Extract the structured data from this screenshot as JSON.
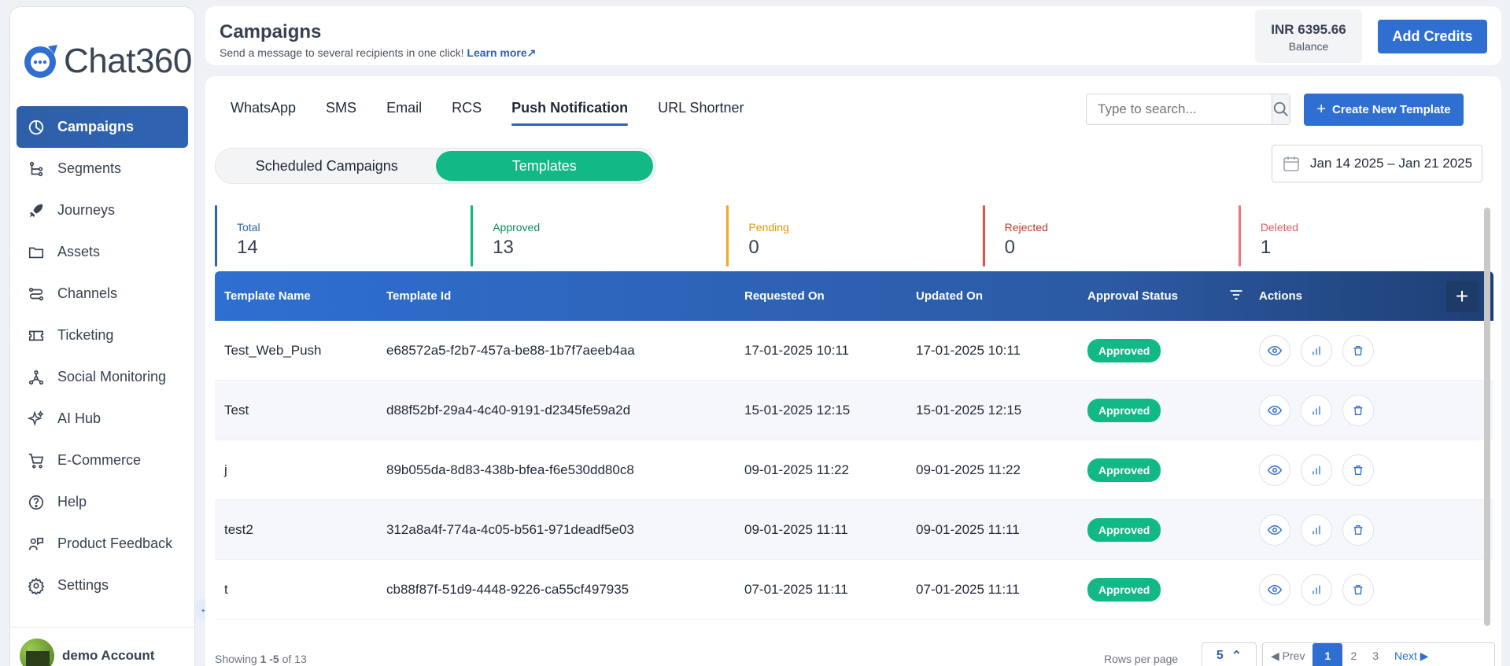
{
  "brand": {
    "name": "Chat360"
  },
  "sidebar": {
    "items": [
      {
        "label": "Campaigns",
        "icon": "pie-chart-icon",
        "active": true
      },
      {
        "label": "Segments",
        "icon": "segments-icon"
      },
      {
        "label": "Journeys",
        "icon": "rocket-icon"
      },
      {
        "label": "Assets",
        "icon": "folder-icon"
      },
      {
        "label": "Channels",
        "icon": "channels-icon"
      },
      {
        "label": "Ticketing",
        "icon": "ticket-icon"
      },
      {
        "label": "Social Monitoring",
        "icon": "network-icon"
      },
      {
        "label": "AI Hub",
        "icon": "sparkle-icon"
      },
      {
        "label": "E-Commerce",
        "icon": "cart-icon"
      },
      {
        "label": "Help",
        "icon": "help-icon"
      },
      {
        "label": "Product Feedback",
        "icon": "feedback-icon"
      },
      {
        "label": "Settings",
        "icon": "gear-icon"
      }
    ],
    "account_name": "demo Account"
  },
  "header": {
    "title": "Campaigns",
    "subtitle": "Send a message to several recipients in one click!",
    "learn_more": "Learn more",
    "balance_amount": "INR 6395.66",
    "balance_label": "Balance",
    "add_credits": "Add Credits"
  },
  "tabs": [
    "WhatsApp",
    "SMS",
    "Email",
    "RCS",
    "Push Notification",
    "URL Shortner"
  ],
  "active_tab": "Push Notification",
  "search": {
    "placeholder": "Type to search..."
  },
  "create_button": "Create New Template",
  "toggle": {
    "options": [
      "Scheduled Campaigns",
      "Templates"
    ],
    "active": "Templates"
  },
  "date_range": "Jan 14 2025 – Jan 21 2025",
  "stats": [
    {
      "label": "Total",
      "value": "14",
      "key": "total"
    },
    {
      "label": "Approved",
      "value": "13",
      "key": "approved"
    },
    {
      "label": "Pending",
      "value": "0",
      "key": "pending"
    },
    {
      "label": "Rejected",
      "value": "0",
      "key": "rejected"
    },
    {
      "label": "Deleted",
      "value": "1",
      "key": "deleted"
    }
  ],
  "table": {
    "headers": [
      "Template Name",
      "Template Id",
      "Requested On",
      "Updated On",
      "Approval Status",
      "Actions"
    ],
    "rows": [
      {
        "name": "Test_Web_Push",
        "id": "e68572a5-f2b7-457a-be88-1b7f7aeeb4aa",
        "requested": "17-01-2025 10:11",
        "updated": "17-01-2025 10:11",
        "status": "Approved"
      },
      {
        "name": "Test",
        "id": "d88f52bf-29a4-4c40-9191-d2345fe59a2d",
        "requested": "15-01-2025 12:15",
        "updated": "15-01-2025 12:15",
        "status": "Approved"
      },
      {
        "name": "j",
        "id": "89b055da-8d83-438b-bfea-f6e530dd80c8",
        "requested": "09-01-2025 11:22",
        "updated": "09-01-2025 11:22",
        "status": "Approved"
      },
      {
        "name": "test2",
        "id": "312a8a4f-774a-4c05-b561-971deadf5e03",
        "requested": "09-01-2025 11:11",
        "updated": "09-01-2025 11:11",
        "status": "Approved"
      },
      {
        "name": "t",
        "id": "cb88f87f-51d9-4448-9226-ca55cf497935",
        "requested": "07-01-2025 11:11",
        "updated": "07-01-2025 11:11",
        "status": "Approved"
      }
    ]
  },
  "footer": {
    "showing_prefix": "Showing ",
    "showing_range": "1 -5",
    "showing_suffix": " of 13",
    "rows_per_page_label": "Rows per page",
    "rows_per_page_value": "5",
    "prev": "Prev",
    "pages": [
      "1",
      "2",
      "3"
    ],
    "next": "Next"
  },
  "colors": {
    "primary": "#2f6fd1",
    "success": "#12b886",
    "sidebar_active": "#2e5fa9"
  }
}
